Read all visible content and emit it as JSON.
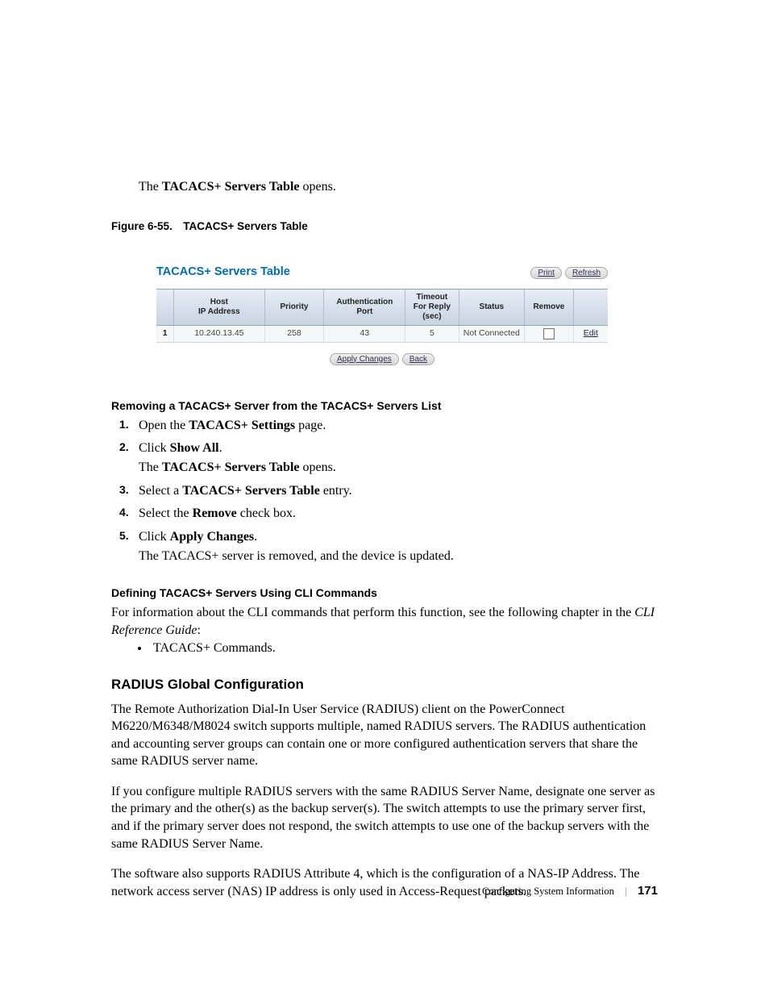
{
  "intro": {
    "pre": "The ",
    "bold": "TACACS+ Servers Table",
    "post": " opens."
  },
  "figure_caption": "Figure 6-55. TACACS+ Servers Table",
  "screenshot": {
    "title": "TACACS+ Servers Table",
    "print_btn": "Print",
    "refresh_btn": "Refresh",
    "headers": {
      "host_l1": "Host",
      "host_l2": "IP Address",
      "priority": "Priority",
      "auth_l1": "Authentication",
      "auth_l2": "Port",
      "timeout_l1": "Timeout",
      "timeout_l2": "For Reply",
      "timeout_l3": "(sec)",
      "status": "Status",
      "remove": "Remove"
    },
    "row": {
      "idx": "1",
      "host": "10.240.13.45",
      "priority": "258",
      "authport": "43",
      "timeout": "5",
      "status": "Not Connected",
      "edit": "Edit"
    },
    "apply_btn": "Apply Changes",
    "back_btn": "Back"
  },
  "removing_head": "Removing a TACACS+ Server from the TACACS+ Servers List",
  "steps": {
    "s1_num": "1.",
    "s1a": "Open the ",
    "s1b": "TACACS+ Settings",
    "s1c": " page.",
    "s2_num": "2.",
    "s2a": "Click ",
    "s2b": "Show All",
    "s2c": ".",
    "s2d_a": "The ",
    "s2d_b": "TACACS+ Servers Table",
    "s2d_c": " opens.",
    "s3_num": "3.",
    "s3a": "Select a ",
    "s3b": "TACACS+ Servers Table",
    "s3c": " entry.",
    "s4_num": "4.",
    "s4a": "Select the ",
    "s4b": "Remove",
    "s4c": " check box.",
    "s5_num": "5.",
    "s5a": "Click ",
    "s5b": "Apply Changes",
    "s5c": ".",
    "s5d": "The TACACS+ server is removed, and the device is updated."
  },
  "defining_head": "Defining TACACS+ Servers Using CLI Commands",
  "defining_para_a": "For information about the CLI commands that perform this function, see the following chapter in the ",
  "defining_para_b": "CLI Reference Guide",
  "defining_para_c": ":",
  "defining_bullet": "TACACS+ Commands.",
  "radius_head": "RADIUS Global Configuration",
  "radius_p1": "The Remote Authorization Dial-In User Service (RADIUS) client on the PowerConnect M6220/M6348/M8024 switch supports multiple, named RADIUS servers. The RADIUS authentication and accounting server groups can contain one or more configured authentication servers that share the same RADIUS server name.",
  "radius_p2": "If you configure multiple RADIUS servers with the same RADIUS Server Name, designate one server as the primary and the other(s) as the backup server(s). The switch attempts to use the primary server first, and if the primary server does not respond, the switch attempts to use one of the backup servers with the same RADIUS Server Name.",
  "radius_p3": "The software also supports RADIUS Attribute 4, which is the configuration of a NAS-IP Address. The network access server (NAS) IP address is only used in Access-Request packets.",
  "footer": {
    "section": "Configuring System Information",
    "page": "171"
  }
}
